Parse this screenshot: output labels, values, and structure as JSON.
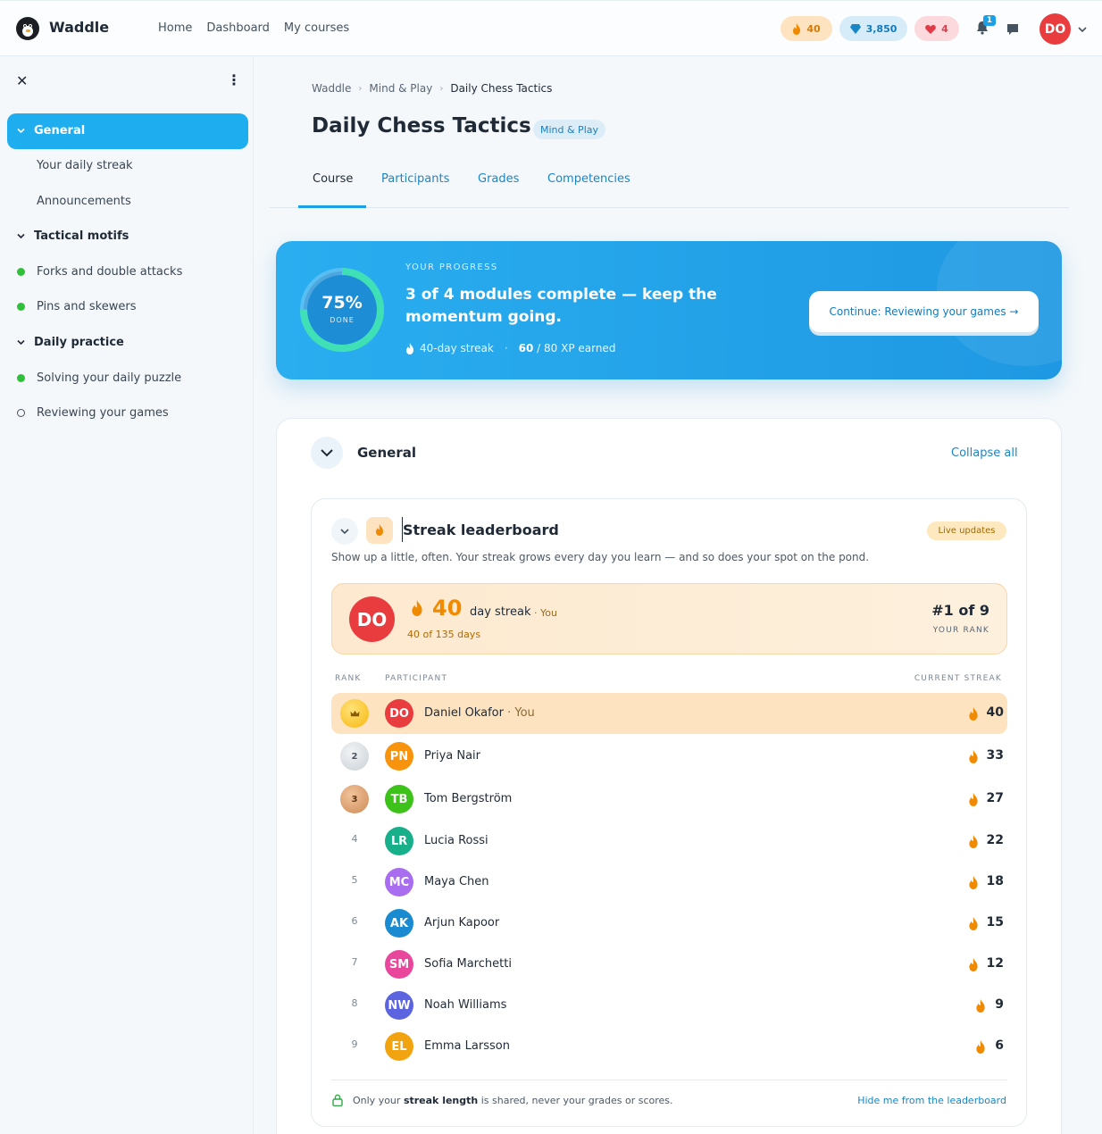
{
  "app": {
    "brand": "Waddle",
    "nav": [
      "Home",
      "Dashboard",
      "My courses"
    ],
    "stats": {
      "streak": "40",
      "gems": "3,850",
      "hearts": "4"
    },
    "notifications_count": "1",
    "user_initials": "DO"
  },
  "sidebar": {
    "items": [
      {
        "label": "General",
        "kind": "section",
        "active": true
      },
      {
        "label": "Your daily streak",
        "kind": "sub"
      },
      {
        "label": "Announcements",
        "kind": "sub"
      },
      {
        "label": "Tactical motifs",
        "kind": "section"
      },
      {
        "label": "Forks and double attacks",
        "kind": "done"
      },
      {
        "label": "Pins and skewers",
        "kind": "done"
      },
      {
        "label": "Daily practice",
        "kind": "section"
      },
      {
        "label": "Solving your daily puzzle",
        "kind": "done"
      },
      {
        "label": "Reviewing your games",
        "kind": "todo"
      }
    ]
  },
  "breadcrumb": [
    "Waddle",
    "Mind & Play",
    "Daily Chess Tactics"
  ],
  "course": {
    "title": "Daily Chess Tactics",
    "category": "Mind & Play",
    "tabs": [
      "Course",
      "Participants",
      "Grades",
      "Competencies"
    ]
  },
  "progress": {
    "percent": 0.75,
    "percent_label": "75%",
    "done_label": "DONE",
    "eyebrow": "YOUR PROGRESS",
    "headline": "3 of 4 modules complete — keep the momentum going.",
    "streak_text": "40-day streak",
    "xp_strong": "60",
    "xp_rest": " / 80 XP earned",
    "cta": "Continue: Reviewing your games →"
  },
  "section": {
    "title": "General",
    "collapse_all": "Collapse all"
  },
  "leaderboard": {
    "title": "Streak leaderboard",
    "live": "Live updates",
    "description": "Show up a little, often. Your streak grows every day you learn — and so does your spot on the pond.",
    "you": {
      "initials": "DO",
      "streak": "40",
      "day_streak": "day streak",
      "you_tag": "· You",
      "sub": "40 of 135 days",
      "rank": "#1 of 9",
      "rank_label": "YOUR RANK"
    },
    "headers": {
      "rank": "RANK",
      "participant": "PARTICIPANT",
      "streak": "CURRENT STREAK"
    },
    "rows": [
      {
        "rank": "1",
        "initials": "DO",
        "name": "Daniel Okafor",
        "you": " · You",
        "streak": "40",
        "color": "#e83c3e"
      },
      {
        "rank": "2",
        "initials": "PN",
        "name": "Priya Nair",
        "streak": "33",
        "color": "#f7930d"
      },
      {
        "rank": "3",
        "initials": "TB",
        "name": "Tom Bergström",
        "streak": "27",
        "color": "#3cc218"
      },
      {
        "rank": "4",
        "initials": "LR",
        "name": "Lucia Rossi",
        "streak": "22",
        "color": "#17b08a"
      },
      {
        "rank": "5",
        "initials": "MC",
        "name": "Maya Chen",
        "streak": "18",
        "color": "#a96df0"
      },
      {
        "rank": "6",
        "initials": "AK",
        "name": "Arjun Kapoor",
        "streak": "15",
        "color": "#1a8bd1"
      },
      {
        "rank": "7",
        "initials": "SM",
        "name": "Sofia Marchetti",
        "streak": "12",
        "color": "#e9479c"
      },
      {
        "rank": "8",
        "initials": "NW",
        "name": "Noah Williams",
        "streak": "9",
        "color": "#5d64e0"
      },
      {
        "rank": "9",
        "initials": "EL",
        "name": "Emma Larsson",
        "streak": "6",
        "color": "#f2a410"
      }
    ],
    "footnote_pre": "Only your ",
    "footnote_strong": "streak length",
    "footnote_post": " is shared, never your grades or scores.",
    "hide_link": "Hide me from the leaderboard"
  },
  "colors": {
    "accent": "#1eaef0",
    "link": "#1a86c7",
    "flame": "#f08a00",
    "highlight": "#fde3c0"
  },
  "icons": [
    "penguin-logo-icon",
    "flame-icon",
    "gem-icon",
    "heart-icon",
    "bell-icon",
    "chat-icon",
    "chevron-down-icon",
    "close-icon",
    "kebab-icon",
    "lock-icon",
    "crown-icon"
  ]
}
